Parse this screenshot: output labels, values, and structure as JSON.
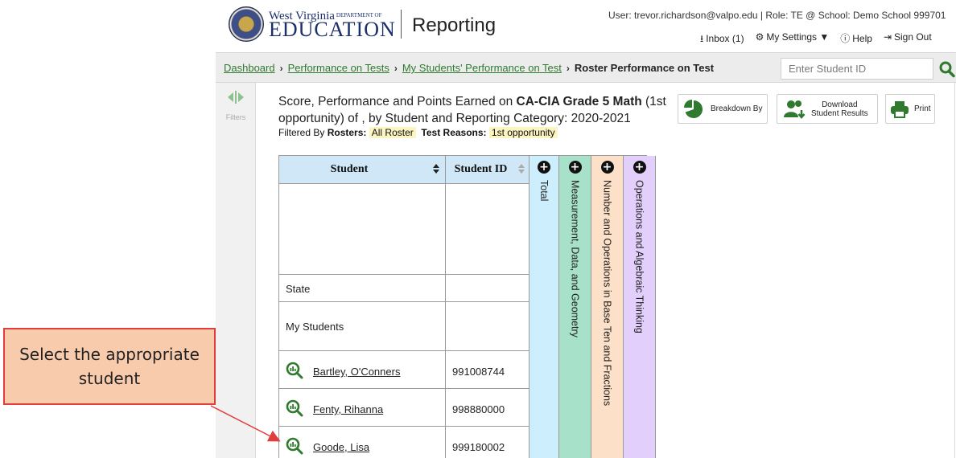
{
  "header": {
    "logo_top": "West Virginia",
    "logo_dept": "DEPARTMENT OF",
    "logo_bottom": "EDUCATION",
    "app_title": "Reporting",
    "user_line": "User: trevor.richardson@valpo.edu  |  Role: TE @ School: Demo School 999701",
    "inbox": "Inbox (1)",
    "settings": "My Settings ▼",
    "help": "Help",
    "signout": "Sign Out"
  },
  "breadcrumb": {
    "items": [
      "Dashboard",
      "Performance on Tests",
      "My Students' Performance on Test"
    ],
    "current": "Roster Performance on Test",
    "student_id_placeholder": "Enter Student ID"
  },
  "rail": {
    "label": "Filters"
  },
  "report": {
    "title_pre": "Score, Performance and Points Earned on ",
    "title_test": "CA-CIA Grade 5 Math",
    "title_post": " (1st opportunity) of , by Student and Reporting Category: 2020-2021",
    "filtered_by": "Filtered By",
    "rosters_label": "Rosters:",
    "rosters_value": "All Roster",
    "reasons_label": "Test Reasons:",
    "reasons_value": "1st opportunity"
  },
  "actions": {
    "breakdown": "Breakdown By",
    "download_1": "Download",
    "download_2": "Student Results",
    "print": "Print"
  },
  "table": {
    "col_student": "Student",
    "col_student_id": "Student ID",
    "categories": [
      "Total",
      "Measurement, Data, and Geometry",
      "Number and Operations in Base Ten and Fractions",
      "Operations and Algebraic Thinking"
    ],
    "category_colors": [
      "#cdeefd",
      "#a8e1c9",
      "#fde0c8",
      "#e2cffb"
    ],
    "summary_rows": [
      "State",
      "My Students"
    ],
    "students": [
      {
        "name": "Bartley, O'Conners",
        "id": "991008744"
      },
      {
        "name": "Fenty, Rihanna",
        "id": "998880000"
      },
      {
        "name": "Goode, Lisa",
        "id": "999180002"
      }
    ]
  },
  "callout": {
    "text": "Select the appropriate student"
  }
}
